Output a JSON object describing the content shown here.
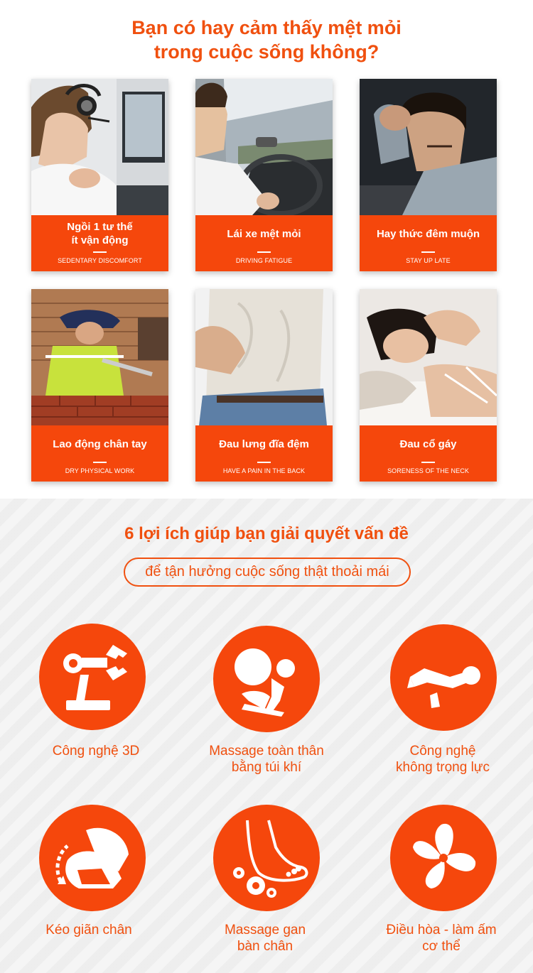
{
  "headline": {
    "line1": "Bạn có hay cảm thấy mệt mỏi",
    "line2": "trong cuộc sống không?"
  },
  "problems": [
    {
      "title": "Ngồi 1 tư thế\nít vận động",
      "subtitle": "SEDENTARY DISCOMFORT"
    },
    {
      "title": "Lái xe mệt mỏi",
      "subtitle": "DRIVING FATIGUE"
    },
    {
      "title": "Hay thức đêm muộn",
      "subtitle": "STAY UP LATE"
    },
    {
      "title": "Lao động chân tay",
      "subtitle": "DRY PHYSICAL WORK"
    },
    {
      "title": "Đau lưng đĩa đệm",
      "subtitle": "HAVE A PAIN IN THE BACK"
    },
    {
      "title": "Đau cổ gáy",
      "subtitle": "SORENESS OF THE NECK"
    }
  ],
  "benefits_section": {
    "title": "6 lợi ích giúp bạn giải quyết vấn đề",
    "pill": "để tận hưởng cuộc sống thật thoải mái"
  },
  "benefits": [
    {
      "label": "Công nghệ 3D",
      "icon": "robot-arm-icon"
    },
    {
      "label": "Massage toàn thân\nbằng túi khí",
      "icon": "airbag-seat-icon"
    },
    {
      "label": "Công nghệ\nkhông trọng lực",
      "icon": "zero-gravity-icon"
    },
    {
      "label": "Kéo giãn chân",
      "icon": "leg-stretch-icon"
    },
    {
      "label": "Massage gan\nbàn chân",
      "icon": "foot-massage-icon"
    },
    {
      "label": "Điều hòa - làm ấm\ncơ thể",
      "icon": "fan-icon"
    }
  ],
  "colors": {
    "accent": "#f5470c",
    "text_accent": "#f0500f",
    "background_gray": "#f0f0f0"
  }
}
